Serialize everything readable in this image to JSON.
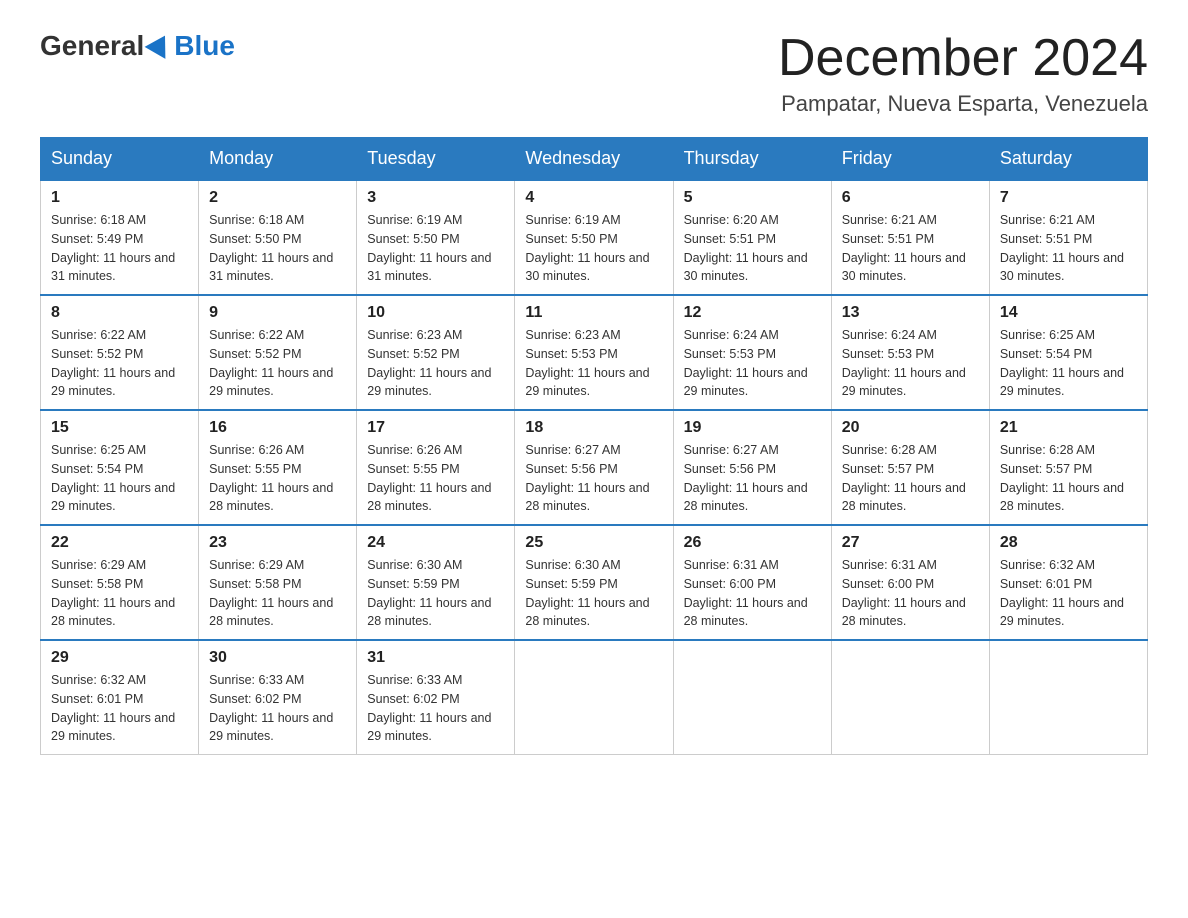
{
  "logo": {
    "general": "General",
    "blue": "Blue"
  },
  "header": {
    "month": "December 2024",
    "location": "Pampatar, Nueva Esparta, Venezuela"
  },
  "weekdays": [
    "Sunday",
    "Monday",
    "Tuesday",
    "Wednesday",
    "Thursday",
    "Friday",
    "Saturday"
  ],
  "weeks": [
    [
      {
        "day": "1",
        "sunrise": "6:18 AM",
        "sunset": "5:49 PM",
        "daylight": "11 hours and 31 minutes."
      },
      {
        "day": "2",
        "sunrise": "6:18 AM",
        "sunset": "5:50 PM",
        "daylight": "11 hours and 31 minutes."
      },
      {
        "day": "3",
        "sunrise": "6:19 AM",
        "sunset": "5:50 PM",
        "daylight": "11 hours and 31 minutes."
      },
      {
        "day": "4",
        "sunrise": "6:19 AM",
        "sunset": "5:50 PM",
        "daylight": "11 hours and 30 minutes."
      },
      {
        "day": "5",
        "sunrise": "6:20 AM",
        "sunset": "5:51 PM",
        "daylight": "11 hours and 30 minutes."
      },
      {
        "day": "6",
        "sunrise": "6:21 AM",
        "sunset": "5:51 PM",
        "daylight": "11 hours and 30 minutes."
      },
      {
        "day": "7",
        "sunrise": "6:21 AM",
        "sunset": "5:51 PM",
        "daylight": "11 hours and 30 minutes."
      }
    ],
    [
      {
        "day": "8",
        "sunrise": "6:22 AM",
        "sunset": "5:52 PM",
        "daylight": "11 hours and 29 minutes."
      },
      {
        "day": "9",
        "sunrise": "6:22 AM",
        "sunset": "5:52 PM",
        "daylight": "11 hours and 29 minutes."
      },
      {
        "day": "10",
        "sunrise": "6:23 AM",
        "sunset": "5:52 PM",
        "daylight": "11 hours and 29 minutes."
      },
      {
        "day": "11",
        "sunrise": "6:23 AM",
        "sunset": "5:53 PM",
        "daylight": "11 hours and 29 minutes."
      },
      {
        "day": "12",
        "sunrise": "6:24 AM",
        "sunset": "5:53 PM",
        "daylight": "11 hours and 29 minutes."
      },
      {
        "day": "13",
        "sunrise": "6:24 AM",
        "sunset": "5:53 PM",
        "daylight": "11 hours and 29 minutes."
      },
      {
        "day": "14",
        "sunrise": "6:25 AM",
        "sunset": "5:54 PM",
        "daylight": "11 hours and 29 minutes."
      }
    ],
    [
      {
        "day": "15",
        "sunrise": "6:25 AM",
        "sunset": "5:54 PM",
        "daylight": "11 hours and 29 minutes."
      },
      {
        "day": "16",
        "sunrise": "6:26 AM",
        "sunset": "5:55 PM",
        "daylight": "11 hours and 28 minutes."
      },
      {
        "day": "17",
        "sunrise": "6:26 AM",
        "sunset": "5:55 PM",
        "daylight": "11 hours and 28 minutes."
      },
      {
        "day": "18",
        "sunrise": "6:27 AM",
        "sunset": "5:56 PM",
        "daylight": "11 hours and 28 minutes."
      },
      {
        "day": "19",
        "sunrise": "6:27 AM",
        "sunset": "5:56 PM",
        "daylight": "11 hours and 28 minutes."
      },
      {
        "day": "20",
        "sunrise": "6:28 AM",
        "sunset": "5:57 PM",
        "daylight": "11 hours and 28 minutes."
      },
      {
        "day": "21",
        "sunrise": "6:28 AM",
        "sunset": "5:57 PM",
        "daylight": "11 hours and 28 minutes."
      }
    ],
    [
      {
        "day": "22",
        "sunrise": "6:29 AM",
        "sunset": "5:58 PM",
        "daylight": "11 hours and 28 minutes."
      },
      {
        "day": "23",
        "sunrise": "6:29 AM",
        "sunset": "5:58 PM",
        "daylight": "11 hours and 28 minutes."
      },
      {
        "day": "24",
        "sunrise": "6:30 AM",
        "sunset": "5:59 PM",
        "daylight": "11 hours and 28 minutes."
      },
      {
        "day": "25",
        "sunrise": "6:30 AM",
        "sunset": "5:59 PM",
        "daylight": "11 hours and 28 minutes."
      },
      {
        "day": "26",
        "sunrise": "6:31 AM",
        "sunset": "6:00 PM",
        "daylight": "11 hours and 28 minutes."
      },
      {
        "day": "27",
        "sunrise": "6:31 AM",
        "sunset": "6:00 PM",
        "daylight": "11 hours and 28 minutes."
      },
      {
        "day": "28",
        "sunrise": "6:32 AM",
        "sunset": "6:01 PM",
        "daylight": "11 hours and 29 minutes."
      }
    ],
    [
      {
        "day": "29",
        "sunrise": "6:32 AM",
        "sunset": "6:01 PM",
        "daylight": "11 hours and 29 minutes."
      },
      {
        "day": "30",
        "sunrise": "6:33 AM",
        "sunset": "6:02 PM",
        "daylight": "11 hours and 29 minutes."
      },
      {
        "day": "31",
        "sunrise": "6:33 AM",
        "sunset": "6:02 PM",
        "daylight": "11 hours and 29 minutes."
      },
      null,
      null,
      null,
      null
    ]
  ]
}
